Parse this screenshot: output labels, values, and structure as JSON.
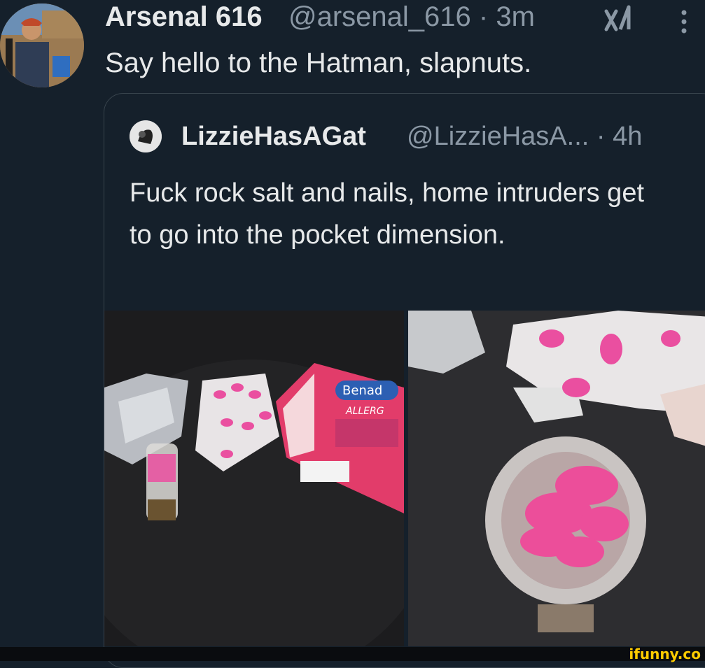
{
  "post": {
    "author_name": "Arsenal 616",
    "author_meta": "@arsenal_616 · 3m",
    "text": "Say hello to the Hatman, slapnuts."
  },
  "quoted_post": {
    "author_name": "LizzieHasAGat",
    "author_meta": "@LizzieHasA... · 4h",
    "text": "Fuck rock salt and nails, home intruders get to go into the pocket dimension.",
    "photos": [
      {
        "name": "photo-left",
        "box_label": "Benad",
        "box_sub": "ALLERG"
      },
      {
        "name": "photo-right"
      }
    ]
  },
  "watermark": "ifunny.co",
  "icons": {
    "grok": "grok-icon",
    "more": "more-options-icon"
  },
  "colors": {
    "background": "#15202b",
    "secondary_text": "#8b98a5",
    "border": "#38444d",
    "pill_pink": "#ea4fa0",
    "watermark": "#ffcc00"
  }
}
